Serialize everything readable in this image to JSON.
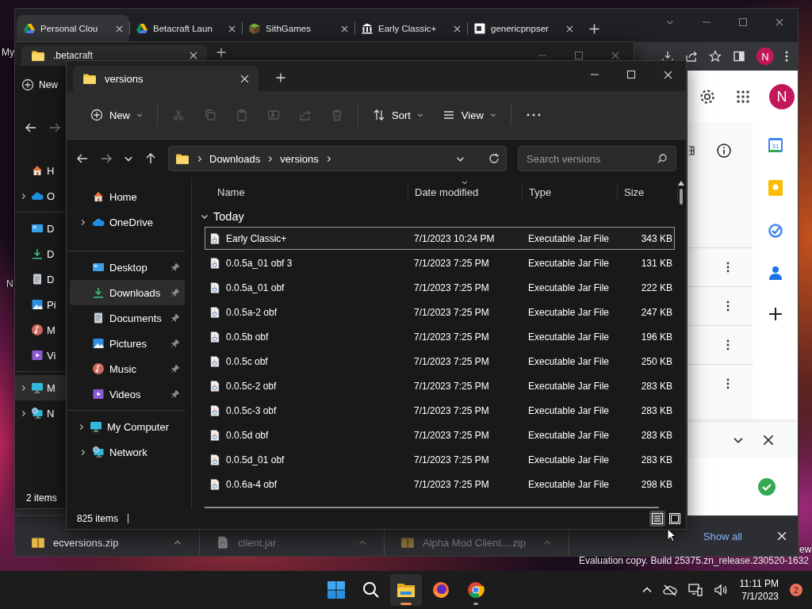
{
  "desktop": {
    "icon_labels": [
      "My",
      "N"
    ],
    "corner_text": "ew",
    "build_text": "Evaluation copy. Build 25375.zn_release.230520-1632"
  },
  "browser": {
    "tabs": [
      {
        "title": "Personal Clou",
        "kind": "drive",
        "selected": true
      },
      {
        "title": "Betacraft Laun",
        "kind": "drive",
        "selected": false
      },
      {
        "title": "SithGames",
        "kind": "block",
        "selected": false
      },
      {
        "title": "Early Classic+",
        "kind": "museum",
        "selected": false
      },
      {
        "title": "genericpnpser",
        "kind": "page",
        "selected": false
      }
    ],
    "profile_initial": "N",
    "side_panel": {
      "profile_initial": "N",
      "calendar_day": "31"
    },
    "downloads": [
      {
        "name": "ecversions.zip",
        "kind": "zip",
        "dimmed": false
      },
      {
        "name": "client.jar",
        "kind": "jar",
        "dimmed": true
      },
      {
        "name": "Alpha Mod Client....zip",
        "kind": "zip",
        "dimmed": true
      }
    ],
    "show_all": "Show all"
  },
  "back_explorer": {
    "tab_title": ".betacraft",
    "new_label": "New",
    "sidebar": {
      "groups": [
        {
          "items": [
            {
              "label": "H",
              "kind": "home",
              "expandable": false,
              "selected": false
            },
            {
              "label": "O",
              "kind": "cloud",
              "expandable": true,
              "selected": false
            }
          ]
        },
        {
          "items": [
            {
              "label": "D",
              "kind": "desktop",
              "expandable": false,
              "selected": false
            },
            {
              "label": "D",
              "kind": "download",
              "expandable": false,
              "selected": false
            },
            {
              "label": "D",
              "kind": "document",
              "expandable": false,
              "selected": false
            },
            {
              "label": "Pi",
              "kind": "picture",
              "expandable": false,
              "selected": false
            },
            {
              "label": "M",
              "kind": "music",
              "expandable": false,
              "selected": false
            },
            {
              "label": "Vi",
              "kind": "video",
              "expandable": false,
              "selected": false
            }
          ]
        },
        {
          "items": [
            {
              "label": "M",
              "kind": "computer",
              "expandable": true,
              "selected": true
            },
            {
              "label": "N",
              "kind": "network",
              "expandable": true,
              "selected": false
            }
          ]
        }
      ]
    },
    "status": "2 items"
  },
  "explorer": {
    "tab_title": "versions",
    "toolbar": {
      "groups": [
        {
          "items": [
            {
              "kind": "new",
              "label": "New",
              "disabled": false
            }
          ]
        },
        {
          "items": [
            {
              "kind": "cut",
              "disabled": true
            },
            {
              "kind": "copy",
              "disabled": true
            },
            {
              "kind": "paste",
              "disabled": true
            },
            {
              "kind": "rename",
              "disabled": true
            },
            {
              "kind": "share",
              "disabled": true
            },
            {
              "kind": "delete",
              "disabled": true
            }
          ]
        },
        {
          "items": [
            {
              "kind": "sort",
              "label": "Sort",
              "disabled": false
            },
            {
              "kind": "view",
              "label": "View",
              "disabled": false
            }
          ]
        },
        {
          "items": [
            {
              "kind": "more",
              "disabled": false
            }
          ]
        }
      ]
    },
    "address": [
      "Downloads",
      "versions"
    ],
    "search": {
      "placeholder": "Search versions"
    },
    "sidebar": {
      "groups": [
        {
          "items": [
            {
              "label": "Home",
              "kind": "home",
              "expandable": false,
              "pinned": false,
              "selected": false
            },
            {
              "label": "OneDrive",
              "kind": "cloud",
              "expandable": true,
              "pinned": false,
              "selected": false
            }
          ]
        },
        {
          "items": [
            {
              "label": "Desktop",
              "kind": "desktop",
              "expandable": false,
              "pinned": true,
              "selected": false
            },
            {
              "label": "Downloads",
              "kind": "download",
              "expandable": false,
              "pinned": true,
              "selected": true
            },
            {
              "label": "Documents",
              "kind": "document",
              "expandable": false,
              "pinned": true,
              "selected": false
            },
            {
              "label": "Pictures",
              "kind": "picture",
              "expandable": false,
              "pinned": true,
              "selected": false
            },
            {
              "label": "Music",
              "kind": "music",
              "expandable": false,
              "pinned": true,
              "selected": false
            },
            {
              "label": "Videos",
              "kind": "video",
              "expandable": false,
              "pinned": true,
              "selected": false
            }
          ]
        },
        {
          "items": [
            {
              "label": "My Computer",
              "kind": "computer",
              "expandable": true,
              "pinned": false,
              "selected": false
            },
            {
              "label": "Network",
              "kind": "network",
              "expandable": true,
              "pinned": false,
              "selected": false
            }
          ]
        }
      ]
    },
    "columns": [
      "Name",
      "Date modified",
      "Type",
      "Size"
    ],
    "group": {
      "label": "Today",
      "expanded": true
    },
    "rows": [
      {
        "name": "Early Classic+",
        "date": "7/1/2023 10:24 PM",
        "type": "Executable Jar File",
        "size": "343 KB",
        "selected": true
      },
      {
        "name": "0.0.5a_01 obf 3",
        "date": "7/1/2023 7:25 PM",
        "type": "Executable Jar File",
        "size": "131 KB",
        "selected": false
      },
      {
        "name": "0.0.5a_01 obf",
        "date": "7/1/2023 7:25 PM",
        "type": "Executable Jar File",
        "size": "222 KB",
        "selected": false
      },
      {
        "name": "0.0.5a-2 obf",
        "date": "7/1/2023 7:25 PM",
        "type": "Executable Jar File",
        "size": "247 KB",
        "selected": false
      },
      {
        "name": "0.0.5b obf",
        "date": "7/1/2023 7:25 PM",
        "type": "Executable Jar File",
        "size": "196 KB",
        "selected": false
      },
      {
        "name": "0.0.5c obf",
        "date": "7/1/2023 7:25 PM",
        "type": "Executable Jar File",
        "size": "250 KB",
        "selected": false
      },
      {
        "name": "0.0.5c-2 obf",
        "date": "7/1/2023 7:25 PM",
        "type": "Executable Jar File",
        "size": "283 KB",
        "selected": false
      },
      {
        "name": "0.0.5c-3 obf",
        "date": "7/1/2023 7:25 PM",
        "type": "Executable Jar File",
        "size": "283 KB",
        "selected": false
      },
      {
        "name": "0.0.5d obf",
        "date": "7/1/2023 7:25 PM",
        "type": "Executable Jar File",
        "size": "283 KB",
        "selected": false
      },
      {
        "name": "0.0.5d_01 obf",
        "date": "7/1/2023 7:25 PM",
        "type": "Executable Jar File",
        "size": "283 KB",
        "selected": false
      },
      {
        "name": "0.0.6a-4 obf",
        "date": "7/1/2023 7:25 PM",
        "type": "Executable Jar File",
        "size": "298 KB",
        "selected": false
      }
    ],
    "status": "825 items",
    "view_modes": [
      {
        "kind": "details",
        "selected": true
      },
      {
        "kind": "tiles",
        "selected": false
      }
    ]
  },
  "taskbar": {
    "apps": [
      {
        "kind": "start",
        "active": false,
        "running": false
      },
      {
        "kind": "search",
        "active": false,
        "running": false
      },
      {
        "kind": "explorer",
        "active": true,
        "running": true
      },
      {
        "kind": "firefox",
        "active": false,
        "running": false
      },
      {
        "kind": "chrome",
        "active": false,
        "running": true
      }
    ],
    "time": "11:11 PM",
    "date": "7/1/2023",
    "notification_count": "2"
  }
}
